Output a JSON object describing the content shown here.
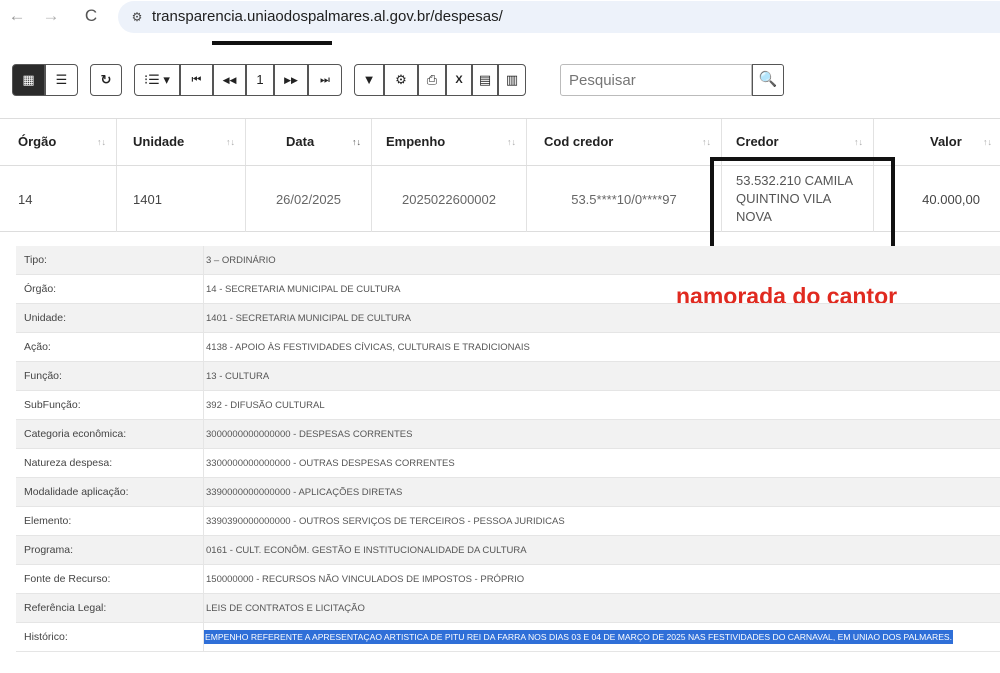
{
  "browser": {
    "back_icon": "←",
    "forward_icon": "→",
    "reload_icon": "C",
    "site_info_icon": "⚙",
    "url": "transparencia.uniaodospalmares.al.gov.br/despesas/"
  },
  "toolbar": {
    "view_grid_icon": "▦",
    "view_list_icon": "☰",
    "refresh_icon": "↻",
    "columns_icon": "⁝☰ ▾",
    "first_icon": "⏮",
    "prev_icon": "◀◀",
    "page_number": "1",
    "next_icon": "▶▶",
    "last_icon": "⏭",
    "filter_icon": "▼",
    "settings_icon": "⚙",
    "print_icon": "⎙",
    "excel_icon": "X",
    "csv_icon": "▤",
    "pdf_icon": "▥",
    "search_placeholder": "Pesquisar",
    "search_icon": "🔍"
  },
  "table": {
    "columns": [
      "Órgão",
      "Unidade",
      "Data",
      "Empenho",
      "Cod credor",
      "Credor",
      "Valor"
    ],
    "sort_icon": "↑↓",
    "row": {
      "orgao": "14",
      "unidade": "1401",
      "data": "26/02/2025",
      "empenho": "2025022600002",
      "cod_credor": "53.5****10/0****97",
      "credor": "53.532.210 CAMILA QUINTINO VILA NOVA",
      "valor": "40.000,00"
    }
  },
  "annotation": {
    "text": "namorada do cantor",
    "color": "#e02a20"
  },
  "details": [
    {
      "label": "Tipo:",
      "value": "3 – ORDINÁRIO"
    },
    {
      "label": "Órgão:",
      "value": "14 - SECRETARIA MUNICIPAL DE CULTURA"
    },
    {
      "label": "Unidade:",
      "value": "1401 - SECRETARIA MUNICIPAL DE CULTURA"
    },
    {
      "label": "Ação:",
      "value": "4138 - APOIO ÀS FESTIVIDADES CÍVICAS, CULTURAIS E TRADICIONAIS"
    },
    {
      "label": "Função:",
      "value": "13 - CULTURA"
    },
    {
      "label": "SubFunção:",
      "value": "392 - DIFUSÃO CULTURAL"
    },
    {
      "label": "Categoria econômica:",
      "value": "3000000000000000 - DESPESAS CORRENTES"
    },
    {
      "label": "Natureza despesa:",
      "value": "3300000000000000 - OUTRAS DESPESAS CORRENTES"
    },
    {
      "label": "Modalidade aplicação:",
      "value": "3390000000000000 - APLICAÇÕES DIRETAS"
    },
    {
      "label": "Elemento:",
      "value": "3390390000000000 - OUTROS SERVIÇOS DE TERCEIROS - PESSOA JURIDICAS"
    },
    {
      "label": "Programa:",
      "value": "0161 - CULT. ECONÔM. GESTÃO E INSTITUCIONALIDADE DA CULTURA"
    },
    {
      "label": "Fonte de Recurso:",
      "value": "150000000 - RECURSOS NÃO VINCULADOS DE IMPOSTOS - PRÓPRIO"
    },
    {
      "label": "Referência Legal:",
      "value": "LEIS DE CONTRATOS E LICITAÇÃO"
    },
    {
      "label": "Histórico:",
      "value": "EMPENHO REFERENTE A APRESENTAÇAO ARTISTICA DE PITU REI DA FARRA NOS DIAS 03 E 04 DE MARÇO DE 2025 NAS FESTIVIDADES DO CARNAVAL, EM UNIAO DOS PALMARES."
    }
  ]
}
